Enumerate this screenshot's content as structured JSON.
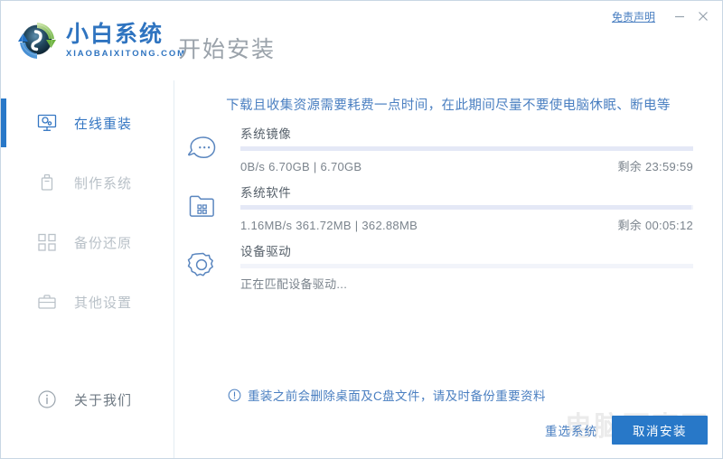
{
  "window": {
    "title": "开始安装",
    "disclaimer_label": "免责声明",
    "minimize_label": "—",
    "close_label": "✕"
  },
  "brand": {
    "name": "小白系统",
    "domain": "XIAOBAIXITONG.COM",
    "logo_icon": "recycle-circle-logo"
  },
  "sidebar": {
    "items": [
      {
        "label": "在线重装",
        "icon": "monitor-icon",
        "active": true,
        "enabled": true
      },
      {
        "label": "制作系统",
        "icon": "usb-drive-icon",
        "active": false,
        "enabled": false
      },
      {
        "label": "备份还原",
        "icon": "grid-blocks-icon",
        "active": false,
        "enabled": false
      },
      {
        "label": "其他设置",
        "icon": "toolbox-icon",
        "active": false,
        "enabled": false
      }
    ],
    "about": {
      "label": "关于我们",
      "icon": "info-circle-icon"
    }
  },
  "main": {
    "notice": "下载且收集资源需要耗费一点时间，在此期间尽量不要使电脑休眠、断电等",
    "tasks": [
      {
        "name": "系统镜像",
        "icon": "cloud-ghost-icon",
        "speed": "0B/s",
        "downloaded": "6.70GB",
        "total": "6.70GB",
        "stat": "0B/s 6.70GB | 6.70GB",
        "remaining_label": "剩余",
        "remaining": "23:59:59",
        "remaining_text": "剩余 23:59:59",
        "percent": 100
      },
      {
        "name": "系统软件",
        "icon": "folder-apps-icon",
        "speed": "1.16MB/s",
        "downloaded": "361.72MB",
        "total": "362.88MB",
        "stat": "1.16MB/s 361.72MB | 362.88MB",
        "remaining_label": "剩余",
        "remaining": "00:05:12",
        "remaining_text": "剩余 00:05:12",
        "percent": 99.7
      },
      {
        "name": "设备驱动",
        "icon": "gear-icon",
        "stat": "正在匹配设备驱动...",
        "remaining_text": "",
        "percent": 0
      }
    ],
    "warning": {
      "icon": "exclamation-circle-icon",
      "text": "重装之前会删除桌面及C盘文件，请及时备份重要资料"
    },
    "watermark": "电脑百事网"
  },
  "footer": {
    "reselect_label": "重选系统",
    "cancel_label": "取消安装"
  },
  "colors": {
    "accent": "#2878c8",
    "link": "#4a7fc1",
    "brand": "#2f74c0",
    "muted": "#b9c1c8",
    "title_gray": "#9aa2aa",
    "progress_track": "#f2f4fa",
    "progress_fill": "#e4e8f6"
  }
}
